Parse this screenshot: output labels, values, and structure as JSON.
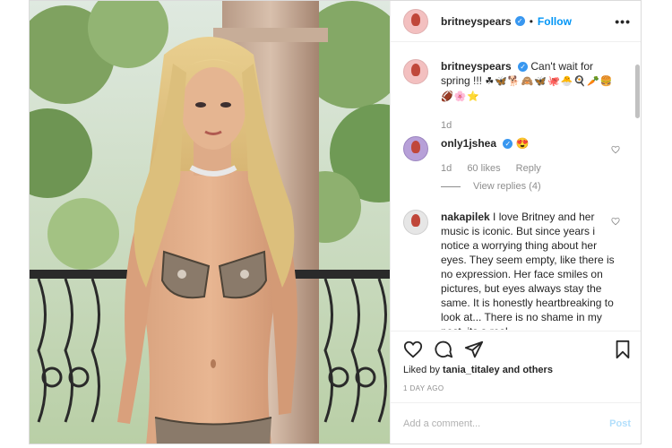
{
  "header": {
    "username": "britneyspears",
    "separator": "•",
    "follow_label": "Follow",
    "more_label": "•••"
  },
  "caption": {
    "username": "britneyspears",
    "text": "Can't wait for spring !!!",
    "emojis": "☘🦋🐕🙈🦋🐙🐣🍳🥕🍔🏈🌸⭐",
    "age": "1d"
  },
  "comments": [
    {
      "username": "only1jshea",
      "text": "😍",
      "age": "1d",
      "likes": "60 likes",
      "reply_label": "Reply",
      "view_replies": "View replies (4)"
    },
    {
      "username": "nakapilek",
      "text": "I love Britney and her music is iconic. But since years i notice a worrying thing about her eyes. They seem empty, like there is no expression. Her face smiles on pictures, but eyes always stay the same. It is honestly heartbreaking to look at... There is no shame in my post, its a real"
    }
  ],
  "actions": {
    "liked_by_prefix": "Liked by",
    "liked_by_user": "tania_titaley",
    "liked_by_suffix": "and others",
    "timestamp": "1 DAY AGO"
  },
  "composer": {
    "placeholder": "Add a comment...",
    "post_label": "Post"
  },
  "colors": {
    "accent": "#0095f6",
    "verified": "#3897f0",
    "muted": "#8e8e8e"
  }
}
